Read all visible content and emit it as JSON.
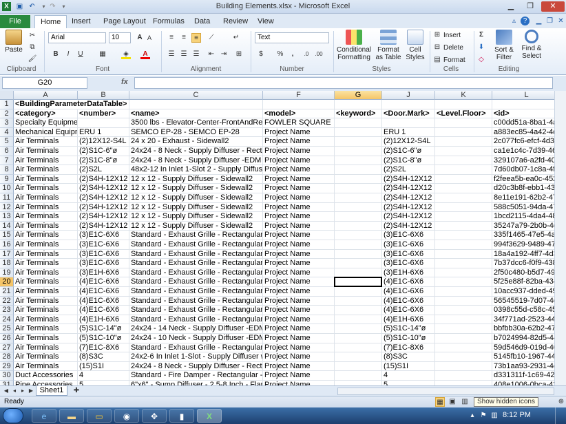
{
  "window": {
    "title": "Building Elements.xlsx - Microsoft Excel",
    "minimize": "▁",
    "restore": "❐",
    "close": "✕"
  },
  "ribbon_tabs": [
    "File",
    "Home",
    "Insert",
    "Page Layout",
    "Formulas",
    "Data",
    "Review",
    "View"
  ],
  "ribbon": {
    "paste": "Paste",
    "font_name": "Arial",
    "font_size": "10",
    "number_format": "Text",
    "conditional_formatting": "Conditional Formatting",
    "format_as_table": "Format as Table",
    "cell_styles": "Cell Styles",
    "insert": "Insert",
    "delete": "Delete",
    "format": "Format",
    "sort_filter": "Sort & Filter",
    "find_select": "Find & Select",
    "groups": [
      "Clipboard",
      "Font",
      "Alignment",
      "Number",
      "Styles",
      "Cells",
      "Editing"
    ]
  },
  "name_box": "G20",
  "fx": "fx",
  "columns": [
    "A",
    "B",
    "C",
    "F",
    "G",
    "J",
    "K",
    "L"
  ],
  "selected_column": "G",
  "selected_row": "20",
  "rows": [
    {
      "n": "1",
      "cells": [
        "<BuildingParameterDataTable>",
        "",
        "",
        "",
        "",
        "",
        "",
        ""
      ]
    },
    {
      "n": "2",
      "cells": [
        "<category>",
        "<number>",
        "<name>",
        "<model>",
        "<keyword>",
        "<Door.Mark>",
        "<Level.Floor>",
        "<id>"
      ]
    },
    {
      "n": "3",
      "cells": [
        "Specialty Equipme",
        "",
        "3500 lbs - Elevator-Center-FrontAndRear",
        "FOWLER SQUARE",
        "",
        "",
        "",
        "c00dd51a-8ba1-4a2"
      ]
    },
    {
      "n": "4",
      "cells": [
        "Mechanical Equipm",
        "ERU 1",
        "SEMCO EP-28 - SEMCO EP-28",
        "Project Name",
        "",
        "ERU 1",
        "",
        "a883ec85-4a42-4d8"
      ]
    },
    {
      "n": "5",
      "cells": [
        "Air Terminals",
        "(2)12X12-S4L",
        "24 x 20 - Exhaust - Sidewall2",
        "Project Name",
        "",
        "(2)12X12-S4L",
        "",
        "2c077fc6-efcf-4d3a"
      ]
    },
    {
      "n": "6",
      "cells": [
        "Air Terminals",
        "(2)S1C-6\"ø",
        "24x24 - 8 Neck - Supply Diffuser - Rectan",
        "Project Name",
        "",
        "(2)S1C-6\"ø",
        "",
        "ca1e1c4c-7d39-463"
      ]
    },
    {
      "n": "7",
      "cells": [
        "Air Terminals",
        "(2)S1C-8\"ø",
        "24x24 - 8 Neck - Supply Diffuser -EDM Ro",
        "Project Name",
        "",
        "(2)S1C-8\"ø",
        "",
        "329107a6-a2fd-404"
      ]
    },
    {
      "n": "8",
      "cells": [
        "Air Terminals",
        "(2)S2L",
        "48x2-12 In Inlet 1-Slot 2 - Supply Diffuser",
        "Project Name",
        "",
        "(2)S2L",
        "",
        "7d60db07-1c8a-4f5"
      ]
    },
    {
      "n": "9",
      "cells": [
        "Air Terminals",
        "(2)S4H-12X12",
        "12 x 12 - Supply Diffuser - Sidewall2",
        "Project Name",
        "",
        "(2)S4H-12X12",
        "",
        "f2feea5b-ea0c-452c"
      ]
    },
    {
      "n": "10",
      "cells": [
        "Air Terminals",
        "(2)S4H-12X12",
        "12 x 12 - Supply Diffuser - Sidewall2",
        "Project Name",
        "",
        "(2)S4H-12X12",
        "",
        "d20c3b8f-ebb1-437"
      ]
    },
    {
      "n": "11",
      "cells": [
        "Air Terminals",
        "(2)S4H-12X12",
        "12 x 12 - Supply Diffuser - Sidewall2",
        "Project Name",
        "",
        "(2)S4H-12X12",
        "",
        "8e11e191-62b2-47f"
      ]
    },
    {
      "n": "12",
      "cells": [
        "Air Terminals",
        "(2)S4H-12X12",
        "12 x 12 - Supply Diffuser - Sidewall2",
        "Project Name",
        "",
        "(2)S4H-12X12",
        "",
        "588c5051-94da-47f"
      ]
    },
    {
      "n": "13",
      "cells": [
        "Air Terminals",
        "(2)S4H-12X12",
        "12 x 12 - Supply Diffuser - Sidewall2",
        "Project Name",
        "",
        "(2)S4H-12X12",
        "",
        "1bcd2115-4da4-480"
      ]
    },
    {
      "n": "14",
      "cells": [
        "Air Terminals",
        "(2)S4H-12X12",
        "12 x 12 - Supply Diffuser - Sidewall2",
        "Project Name",
        "",
        "(2)S4H-12X12",
        "",
        "35247a79-2b0b-4d6"
      ]
    },
    {
      "n": "15",
      "cells": [
        "Air Terminals",
        "(3)E1C-6X6",
        "Standard - Exhaust Grille - Rectangular F",
        "Project Name",
        "",
        "(3)E1C-6X6",
        "",
        "335f1465-47e5-4a8"
      ]
    },
    {
      "n": "16",
      "cells": [
        "Air Terminals",
        "(3)E1C-6X6",
        "Standard - Exhaust Grille - Rectangular F",
        "Project Name",
        "",
        "(3)E1C-6X6",
        "",
        "994f3629-9489-472"
      ]
    },
    {
      "n": "17",
      "cells": [
        "Air Terminals",
        "(3)E1C-6X6",
        "Standard - Exhaust Grille - Rectangular F",
        "Project Name",
        "",
        "(3)E1C-6X6",
        "",
        "18a4a192-4ff7-4d3c"
      ]
    },
    {
      "n": "18",
      "cells": [
        "Air Terminals",
        "(3)E1C-6X6",
        "Standard - Exhaust Grille - Rectangular F",
        "Project Name",
        "",
        "(3)E1C-6X6",
        "",
        "7b37dcc6-f0f9-4388"
      ]
    },
    {
      "n": "19",
      "cells": [
        "Air Terminals",
        "(3)E1H-6X6",
        "Standard - Exhaust Grille - Rectangular F",
        "Project Name",
        "",
        "(3)E1H-6X6",
        "",
        "2f50c480-b5d7-49b"
      ]
    },
    {
      "n": "20",
      "cells": [
        "Air Terminals",
        "(4)E1C-6X6",
        "Standard - Exhaust Grille - Rectangular F",
        "Project Name",
        "",
        "(4)E1C-6X6",
        "",
        "5f25e88f-82ba-4349"
      ]
    },
    {
      "n": "21",
      "cells": [
        "Air Terminals",
        "(4)E1C-6X6",
        "Standard - Exhaust Grille - Rectangular F",
        "Project Name",
        "",
        "(4)E1C-6X6",
        "",
        "10acc937-dded-493"
      ]
    },
    {
      "n": "22",
      "cells": [
        "Air Terminals",
        "(4)E1C-6X6",
        "Standard - Exhaust Grille - Rectangular F",
        "Project Name",
        "",
        "(4)E1C-6X6",
        "",
        "56545519-7d07-4d8"
      ]
    },
    {
      "n": "23",
      "cells": [
        "Air Terminals",
        "(4)E1C-6X6",
        "Standard - Exhaust Grille - Rectangular F",
        "Project Name",
        "",
        "(4)E1C-6X6",
        "",
        "0398c55d-c58c-457"
      ]
    },
    {
      "n": "24",
      "cells": [
        "Air Terminals",
        "(4)E1H-6X6",
        "Standard - Exhaust Grille - Rectangular F",
        "Project Name",
        "",
        "(4)E1H-6X6",
        "",
        "34f771ad-2523-448"
      ]
    },
    {
      "n": "25",
      "cells": [
        "Air Terminals",
        "(5)S1C-14\"ø",
        "24x24 - 14 Neck - Supply Diffuser -EDM F",
        "Project Name",
        "",
        "(5)S1C-14\"ø",
        "",
        "bbfbb30a-62b2-477"
      ]
    },
    {
      "n": "26",
      "cells": [
        "Air Terminals",
        "(5)S1C-10\"ø",
        "24x24 - 10 Neck - Supply Diffuser -EDM F",
        "Project Name",
        "",
        "(5)S1C-10\"ø",
        "",
        "b7024994-82d5-44e"
      ]
    },
    {
      "n": "27",
      "cells": [
        "Air Terminals",
        "(7)E1C-8X6",
        "Standard - Exhaust Grille - Rectangular F",
        "Project Name",
        "",
        "(7)E1C-8X6",
        "",
        "59d546d9-019d-405"
      ]
    },
    {
      "n": "28",
      "cells": [
        "Air Terminals",
        "(8)S3C",
        "24x2-6 In Inlet 1-Slot - Supply Diffuser wit",
        "Project Name",
        "",
        "(8)S3C",
        "",
        "5145fb10-1967-444"
      ]
    },
    {
      "n": "29",
      "cells": [
        "Air Terminals",
        "(15)S1I",
        "24x24 - 8 Neck - Supply Diffuser - Rectan",
        "Project Name",
        "",
        "(15)S1I",
        "",
        "73b1aa93-2931-4c7"
      ]
    },
    {
      "n": "30",
      "cells": [
        "Duct Accessories",
        "4",
        "Standard - Fire Damper - Rectangular - Si",
        "Project Name",
        "",
        "4",
        "",
        "d331311f-1c69-42d"
      ]
    },
    {
      "n": "31",
      "cells": [
        "Pipe Accessories",
        "5",
        "6\"x6\" - Sump Diffuser - 2.5-8 Inch - Flan",
        "Project Name",
        "",
        "5",
        "",
        "408e1006-0bca-43c"
      ]
    }
  ],
  "sheet_tab": "Sheet1",
  "status": "Ready",
  "tooltip": "Show hidden icons",
  "clock": "8:12 PM"
}
